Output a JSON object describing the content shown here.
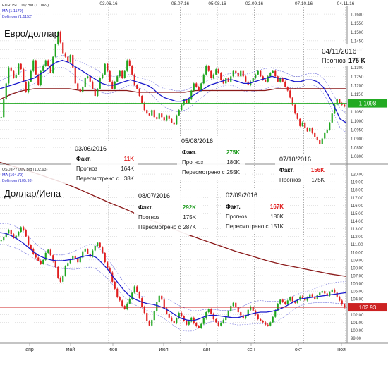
{
  "chart_data": [
    {
      "type": "candlestick",
      "title": "Евро/доллар",
      "legend": [
        "EURUSD Day Bid (1.1069)",
        "MA (1.1179)",
        "Bollinger (1.1152)"
      ],
      "ylim": [
        1.0775,
        1.164
      ],
      "yticks": [
        "1.1600",
        "1.1550",
        "1.1500",
        "1.1450",
        "1.1400",
        "1.1350",
        "1.1300",
        "1.1250",
        "1.1200",
        "1.1150",
        "1.1100",
        "1.1050",
        "1.1000",
        "1.0950",
        "1.0900",
        "1.0850",
        "1.0800"
      ],
      "ytick_values": [
        1.16,
        1.155,
        1.15,
        1.145,
        1.14,
        1.135,
        1.13,
        1.125,
        1.12,
        1.115,
        1.11,
        1.105,
        1.1,
        1.095,
        1.09,
        1.085,
        1.08
      ],
      "last_price": "1.1098",
      "last_price_value": 1.1098,
      "top_date_labels": [
        "03.06.16",
        "08.07.16",
        "05.08.16",
        "02.09.16",
        "07.10.16",
        "04.11.16"
      ],
      "x_range": [
        0,
        140
      ],
      "event_x": [
        44,
        73,
        88,
        103,
        123,
        140
      ],
      "close": [
        1.102,
        1.112,
        1.121,
        1.13,
        1.128,
        1.124,
        1.126,
        1.132,
        1.129,
        1.122,
        1.116,
        1.122,
        1.128,
        1.134,
        1.126,
        1.12,
        1.128,
        1.131,
        1.134,
        1.131,
        1.127,
        1.136,
        1.143,
        1.15,
        1.144,
        1.138,
        1.136,
        1.133,
        1.137,
        1.13,
        1.121,
        1.118,
        1.116,
        1.119,
        1.124,
        1.125,
        1.122,
        1.118,
        1.114,
        1.118,
        1.124,
        1.126,
        1.132,
        1.128,
        1.122,
        1.118,
        1.122,
        1.125,
        1.128,
        1.124,
        1.128,
        1.134,
        1.131,
        1.126,
        1.12,
        1.118,
        1.114,
        1.11,
        1.106,
        1.104,
        1.103,
        1.106,
        1.102,
        1.101,
        1.104,
        1.102,
        1.1,
        1.103,
        1.101,
        1.099,
        1.098,
        1.103,
        1.106,
        1.109,
        1.112,
        1.11,
        1.112,
        1.117,
        1.121,
        1.119,
        1.117,
        1.121,
        1.126,
        1.131,
        1.128,
        1.124,
        1.126,
        1.129,
        1.127,
        1.123,
        1.121,
        1.124,
        1.122,
        1.125,
        1.128,
        1.127,
        1.125,
        1.128,
        1.125,
        1.122,
        1.12,
        1.122,
        1.124,
        1.126,
        1.128,
        1.125,
        1.123,
        1.122,
        1.125,
        1.127,
        1.128,
        1.125,
        1.122,
        1.124,
        1.122,
        1.119,
        1.117,
        1.113,
        1.109,
        1.104,
        1.101,
        1.097,
        1.099,
        1.096,
        1.094,
        1.096,
        1.093,
        1.091,
        1.089,
        1.087,
        1.09,
        1.093,
        1.095,
        1.099,
        1.104,
        1.109,
        1.112,
        1.11,
        1.109,
        1.108
      ],
      "ma": [
        1.118,
        1.119,
        1.12,
        1.121,
        1.122,
        1.123,
        1.124,
        1.126,
        1.128,
        1.131,
        1.133,
        1.134,
        1.133,
        1.131,
        1.129,
        1.127,
        1.125,
        1.123,
        1.121,
        1.12,
        1.12,
        1.121,
        1.122,
        1.123,
        1.122,
        1.121,
        1.12,
        1.118,
        1.115,
        1.113,
        1.112,
        1.111,
        1.111,
        1.112,
        1.114,
        1.116,
        1.118,
        1.12,
        1.121,
        1.122,
        1.123,
        1.123,
        1.122,
        1.121,
        1.121,
        1.122,
        1.123,
        1.124,
        1.125,
        1.124,
        1.124,
        1.123,
        1.122,
        1.122,
        1.123,
        1.123,
        1.122,
        1.119,
        1.114,
        1.108,
        1.101,
        1.099
      ],
      "ma2": [
        1.112,
        1.115,
        1.117,
        1.118,
        1.118,
        1.118,
        1.118,
        1.117,
        1.117,
        1.117,
        1.117,
        1.117,
        1.116,
        1.116,
        1.116,
        1.116,
        1.116,
        1.117,
        1.117,
        1.117,
        1.117,
        1.117,
        1.117,
        1.117,
        1.118,
        1.118,
        1.118,
        1.118,
        1.118,
        1.118,
        1.118
      ]
    },
    {
      "type": "candlestick",
      "title": "Доллар/Иена",
      "legend": [
        "USDJPY Day Bid (102.93)",
        "MA (104.79)",
        "Bollinger (105.93)"
      ],
      "ylim": [
        98.6,
        121.0
      ],
      "yticks": [
        "120.00",
        "119.00",
        "118.00",
        "117.00",
        "116.00",
        "115.00",
        "114.00",
        "113.00",
        "112.00",
        "111.00",
        "110.00",
        "109.00",
        "108.00",
        "107.00",
        "106.00",
        "105.00",
        "104.00",
        "103.00",
        "102.00",
        "101.00",
        "100.00",
        "99.00"
      ],
      "ytick_values": [
        120,
        119,
        118,
        117,
        116,
        115,
        114,
        113,
        112,
        111,
        110,
        109,
        108,
        107,
        106,
        105,
        104,
        103,
        102,
        101,
        100,
        99
      ],
      "last_price": "102.93",
      "last_price_value": 102.93,
      "x_range": [
        0,
        140
      ],
      "event_x": [
        44,
        73,
        88,
        103,
        123,
        140
      ],
      "close": [
        111.5,
        111.9,
        112.4,
        112.8,
        112.3,
        111.8,
        112.1,
        112.6,
        113.2,
        112.8,
        112.0,
        110.9,
        110.4,
        109.8,
        109.3,
        108.9,
        108.5,
        109.0,
        109.9,
        110.3,
        109.6,
        108.8,
        108.1,
        106.7,
        106.2,
        107.0,
        108.2,
        108.6,
        109.1,
        109.5,
        109.2,
        108.7,
        109.3,
        110.1,
        110.4,
        109.8,
        109.4,
        110.2,
        110.8,
        111.2,
        110.6,
        109.9,
        108.7,
        108.0,
        107.4,
        106.2,
        105.3,
        104.2,
        103.8,
        103.1,
        102.7,
        103.4,
        104.0,
        104.8,
        105.6,
        104.9,
        104.1,
        103.0,
        102.2,
        101.2,
        100.6,
        101.3,
        102.4,
        103.6,
        104.4,
        103.9,
        102.8,
        102.1,
        101.6,
        101.2,
        100.9,
        101.5,
        102.2,
        101.8,
        101.2,
        100.7,
        101.1,
        101.6,
        100.9,
        100.5,
        100.3,
        100.8,
        101.5,
        102.3,
        102.7,
        102.1,
        101.4,
        101.0,
        100.6,
        100.9,
        101.3,
        101.8,
        102.4,
        103.1,
        103.5,
        102.9,
        102.3,
        101.9,
        101.5,
        101.8,
        102.6,
        103.0,
        102.5,
        102.0,
        101.4,
        101.2,
        101.0,
        100.7,
        100.6,
        101.0,
        101.7,
        102.5,
        103.4,
        103.9,
        103.6,
        103.3,
        103.8,
        104.2,
        103.7,
        103.5,
        103.9,
        104.3,
        104.1,
        103.8,
        104.2,
        104.6,
        104.3,
        104.0,
        104.5,
        104.8,
        105.0,
        104.7,
        104.4,
        104.9,
        105.2,
        104.8,
        104.3,
        103.8,
        103.3,
        102.9
      ],
      "ma": [
        112.5,
        112.4,
        112.1,
        111.7,
        111.2,
        110.6,
        110.0,
        109.5,
        109.2,
        109.0,
        108.9,
        108.9,
        109.0,
        109.1,
        109.3,
        109.5,
        109.6,
        109.3,
        108.6,
        107.8,
        106.8,
        105.9,
        105.0,
        104.3,
        103.9,
        103.6,
        103.4,
        103.3,
        103.1,
        102.8,
        102.4,
        101.9,
        101.5,
        101.3,
        101.2,
        101.4,
        101.7,
        101.9,
        101.9,
        101.8,
        101.7,
        101.6,
        101.6,
        101.8,
        102.0,
        102.2,
        102.3,
        102.3,
        102.4,
        102.6,
        102.9,
        103.3,
        103.7,
        104.0,
        104.1,
        104.2,
        104.3,
        104.4,
        104.5,
        104.6,
        104.7,
        104.8
      ],
      "ma2": [
        121.5,
        120.9,
        120.3,
        119.6,
        118.9,
        118.1,
        117.2,
        116.3,
        115.5,
        114.6,
        113.8,
        113.0,
        112.2,
        111.5,
        110.8,
        110.1,
        109.5,
        108.9,
        108.4,
        108.0,
        107.6,
        107.2,
        106.9
      ]
    }
  ],
  "bottom_axis_labels": [
    "апр",
    "май",
    "июн",
    "июл",
    "авг",
    "сен",
    "окт",
    "ноя"
  ],
  "eur_annotations": [
    {
      "date": "03/06/2016",
      "rows": [
        {
          "label": "Факт.",
          "value": "11K",
          "color": "#e02020"
        },
        {
          "label": "Прогноз",
          "value": "164K"
        },
        {
          "label": "Пересмотрено с",
          "value": "38K"
        }
      ]
    },
    {
      "date": "05/08/2016",
      "rows": [
        {
          "label": "Факт.",
          "value": "275K",
          "color": "#1c9a1c"
        },
        {
          "label": "Прогноз",
          "value": "180K"
        },
        {
          "label": "Пересмотрено с",
          "value": "255K"
        }
      ]
    },
    {
      "date": "07/10/2016",
      "rows": [
        {
          "label": "Факт.",
          "value": "156K",
          "color": "#e02020"
        },
        {
          "label": "Прогноз",
          "value": "175K"
        }
      ]
    }
  ],
  "jpy_annotations": [
    {
      "date": "08/07/2016",
      "rows": [
        {
          "label": "Факт.",
          "value": "292K",
          "color": "#1c9a1c"
        },
        {
          "label": "Прогноз",
          "value": "175K"
        },
        {
          "label": "Пересмотрено с",
          "value": "287K"
        }
      ]
    },
    {
      "date": "02/09/2016",
      "rows": [
        {
          "label": "Факт.",
          "value": "167K",
          "color": "#e02020"
        },
        {
          "label": "Прогноз",
          "value": "180K"
        },
        {
          "label": "Пересмотрено с",
          "value": "151K"
        }
      ]
    }
  ],
  "forecast_note": {
    "date": "04/11/2016",
    "label": "Прогноз",
    "value": "175 K"
  },
  "colors": {
    "up": "#1ea51e",
    "down": "#e01e1e",
    "ma": "#1a1acc",
    "ma_long": "#8b1a1a",
    "bollinger": "#3333cc",
    "price_line_eur": "#22aa22",
    "price_line_jpy": "#cc2222",
    "grid": "#c8c8c8"
  }
}
